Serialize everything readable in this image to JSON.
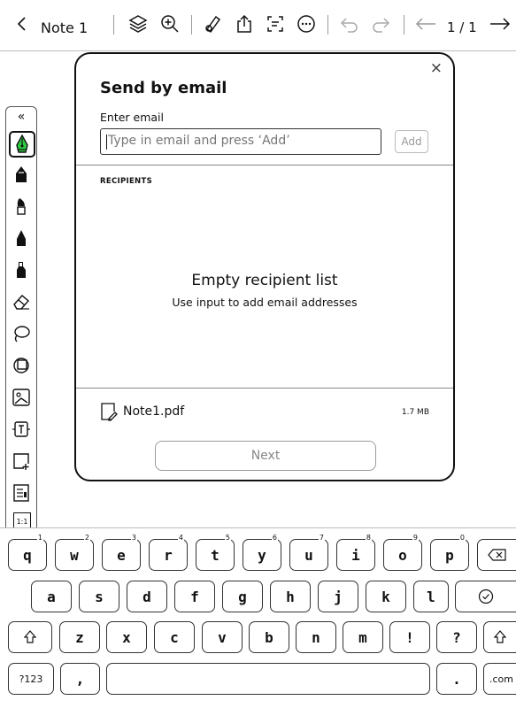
{
  "topbar": {
    "title": "Note 1",
    "pager": "1 / 1",
    "icons": [
      "back-chevron-icon",
      "layers-icon",
      "zoom-in-icon",
      "pen-settings-icon",
      "share-icon",
      "ocr-text-icon",
      "more-icon",
      "undo-icon",
      "redo-icon",
      "prev-page-icon",
      "next-page-icon"
    ]
  },
  "toolbar": {
    "collapse_label": "«",
    "tools": [
      "fountain-pen-icon",
      "pencil-icon",
      "brush-icon",
      "marker-icon",
      "highlighter-icon",
      "eraser-icon",
      "lasso-icon",
      "shapes-icon",
      "image-icon",
      "textbox-icon",
      "add-page-icon",
      "layout-icon",
      "ratio-icon"
    ],
    "ratio_label": "1:1"
  },
  "dialog": {
    "title": "Send by email",
    "close": "×",
    "email_label": "Enter email",
    "email_placeholder": "Type in email and press ‘Add’",
    "add_label": "Add",
    "recipients_label": "RECIPIENTS",
    "empty_title": "Empty recipient list",
    "empty_subtitle": "Use input to add email addresses",
    "file_name": "Note1.pdf",
    "file_size": "1.7 MB",
    "next_label": "Next"
  },
  "keyboard": {
    "row1": [
      {
        "k": "q",
        "s": "1"
      },
      {
        "k": "w",
        "s": "2"
      },
      {
        "k": "e",
        "s": "3"
      },
      {
        "k": "r",
        "s": "4"
      },
      {
        "k": "t",
        "s": "5"
      },
      {
        "k": "y",
        "s": "6"
      },
      {
        "k": "u",
        "s": "7"
      },
      {
        "k": "i",
        "s": "8"
      },
      {
        "k": "o",
        "s": "9"
      },
      {
        "k": "p",
        "s": "0"
      }
    ],
    "row2": [
      "a",
      "s",
      "d",
      "f",
      "g",
      "h",
      "j",
      "k",
      "l"
    ],
    "row3": [
      "z",
      "x",
      "c",
      "v",
      "b",
      "n",
      "m",
      "!",
      "?"
    ],
    "sym_label": "?123",
    "comma_label": ",",
    "period_label": ".",
    "com_label": ".com",
    "icons": [
      "backspace-icon",
      "enter-icon",
      "shift-icon"
    ]
  }
}
